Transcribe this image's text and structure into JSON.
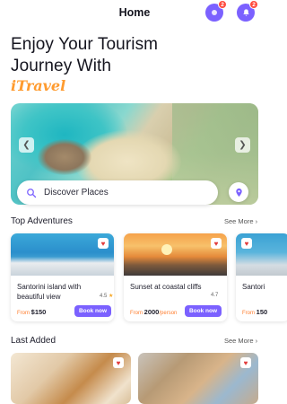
{
  "header": {
    "title": "Home",
    "profile_badge": "2",
    "notification_badge": "2"
  },
  "hero": {
    "title_line1": "Enjoy Your Tourism",
    "title_line2": "Journey With",
    "brand": "iTravel"
  },
  "search": {
    "placeholder": "Discover Places"
  },
  "sections": {
    "top_adventures": {
      "title": "Top Adventures",
      "see_more": "See More"
    },
    "last_added": {
      "title": "Last Added",
      "see_more": "See More"
    }
  },
  "adventures": [
    {
      "name": "Santorini island with beautiful view",
      "rating": "4.5",
      "price_prefix": "From",
      "price": "$150",
      "book_label": "Book now"
    },
    {
      "name": "Sunset at coastal cliffs",
      "rating": "4.7",
      "price_prefix": "From",
      "price": "2000",
      "price_suffix": "/person",
      "book_label": "Book now"
    },
    {
      "name": "Santori",
      "price_prefix": "From",
      "price": "150"
    }
  ],
  "colors": {
    "accent": "#7b61ff",
    "brand": "#ff9b2f",
    "badge": "#ff4b3e",
    "heart": "#e23b3b"
  },
  "icons": {
    "profile": "profile-icon",
    "notification": "bell-icon",
    "search": "search-icon",
    "location": "location-pin-icon",
    "favorite": "heart-icon"
  }
}
